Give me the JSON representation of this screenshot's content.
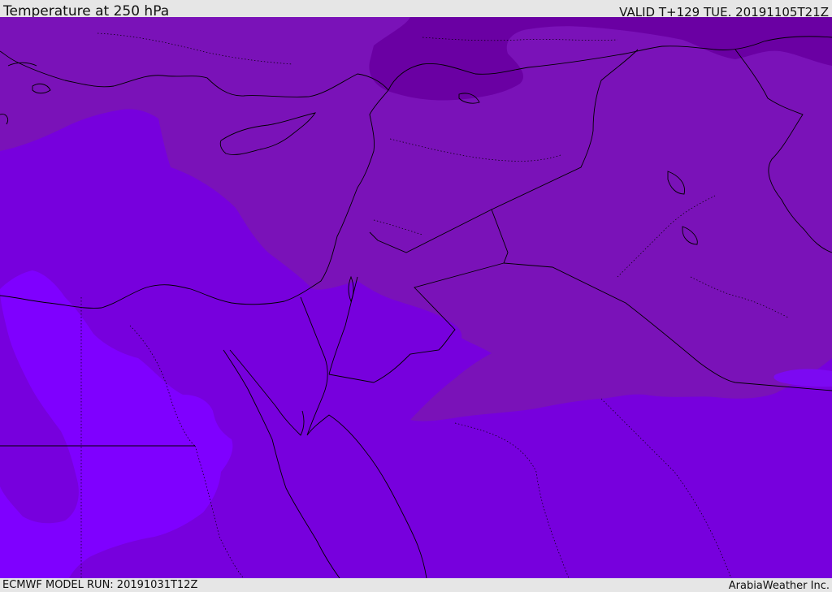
{
  "header": {
    "title": "Temperature at 250 hPa",
    "valid": "VALID T+129 TUE. 20191105T21Z"
  },
  "footer": {
    "model_run": "ECMWF MODEL RUN: 20191031T12Z",
    "credit": "ArabiaWeather Inc."
  },
  "map": {
    "colors": {
      "base": "#7700dd",
      "warm_band": "#7a12b8",
      "cold_core": "#6a00a3",
      "warmest": "#7f00ff",
      "warm_pocket": "#7c09f2",
      "border": "#000000"
    },
    "fields": [
      {
        "name": "warmest-zone-west",
        "color_key": "warmest"
      },
      {
        "name": "warm-tongue-sinai",
        "color_key": "warm_pocket"
      },
      {
        "name": "cold-band-north",
        "color_key": "warm_band"
      },
      {
        "name": "cold-core-north",
        "color_key": "cold_core"
      }
    ]
  }
}
